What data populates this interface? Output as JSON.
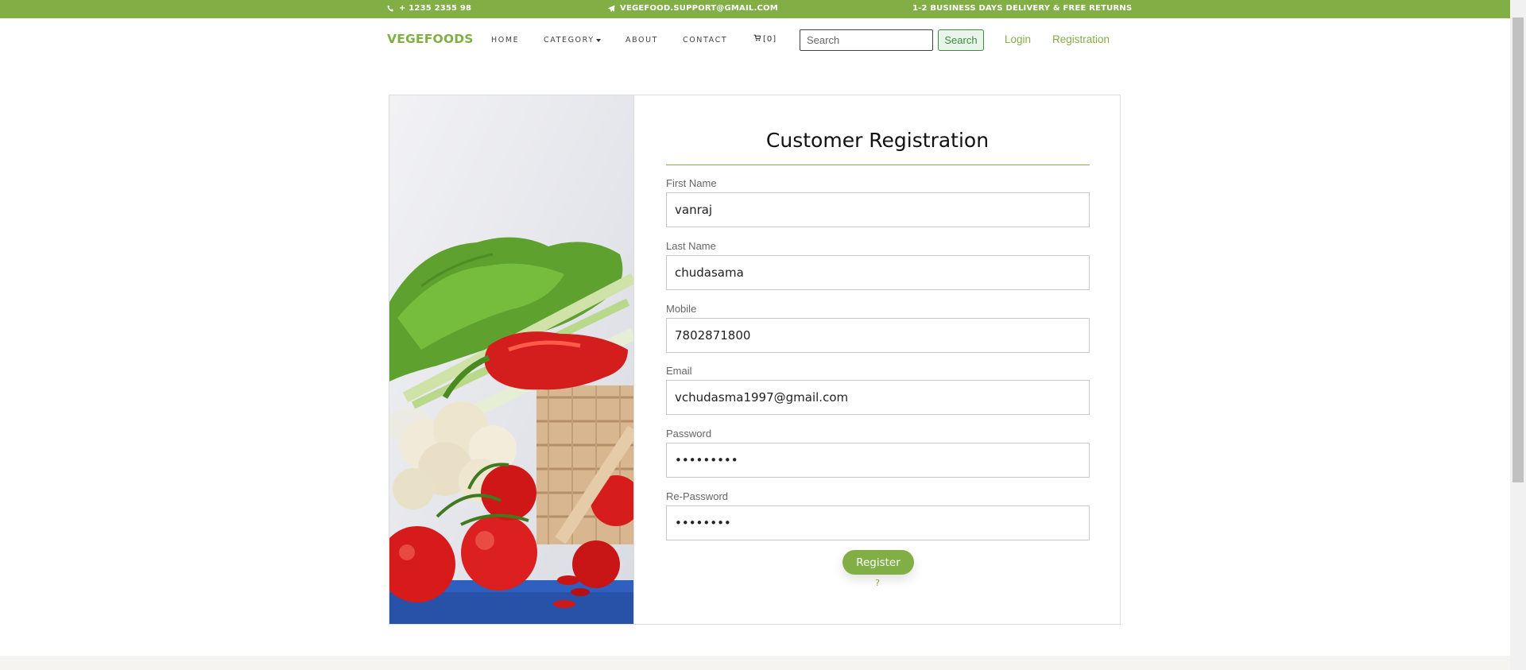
{
  "topbar": {
    "phone": "+ 1235 2355 98",
    "email": "VEGEFOOD.SUPPORT@GMAIL.COM",
    "delivery": "1-2 BUSINESS DAYS DELIVERY & FREE RETURNS",
    "phone_icon": "phone-icon",
    "email_icon": "paper-plane-icon"
  },
  "nav": {
    "brand": "VEGEFOODS",
    "links": [
      "HOME",
      "CATEGORY",
      "ABOUT",
      "CONTACT"
    ],
    "cart_label": "[0]",
    "cart_icon": "cart-icon",
    "search_placeholder": "Search",
    "search_button": "Search",
    "login": "Login",
    "registration": "Registration"
  },
  "form": {
    "title": "Customer Registration",
    "fields": [
      {
        "label": "First Name",
        "value": "vanraj",
        "type": "text"
      },
      {
        "label": "Last Name",
        "value": "chudasama",
        "type": "text"
      },
      {
        "label": "Mobile",
        "value": "7802871800",
        "type": "text"
      },
      {
        "label": "Email",
        "value": "vchudasma1997@gmail.com",
        "type": "text"
      },
      {
        "label": "Password",
        "value": "•••••••••",
        "type": "password"
      },
      {
        "label": "Re-Password",
        "value": "••••••••",
        "type": "password"
      }
    ],
    "register_button": "Register",
    "help_mark": "?"
  },
  "colors": {
    "brand_green": "#82ae46",
    "search_green": "#3c8a3c"
  }
}
